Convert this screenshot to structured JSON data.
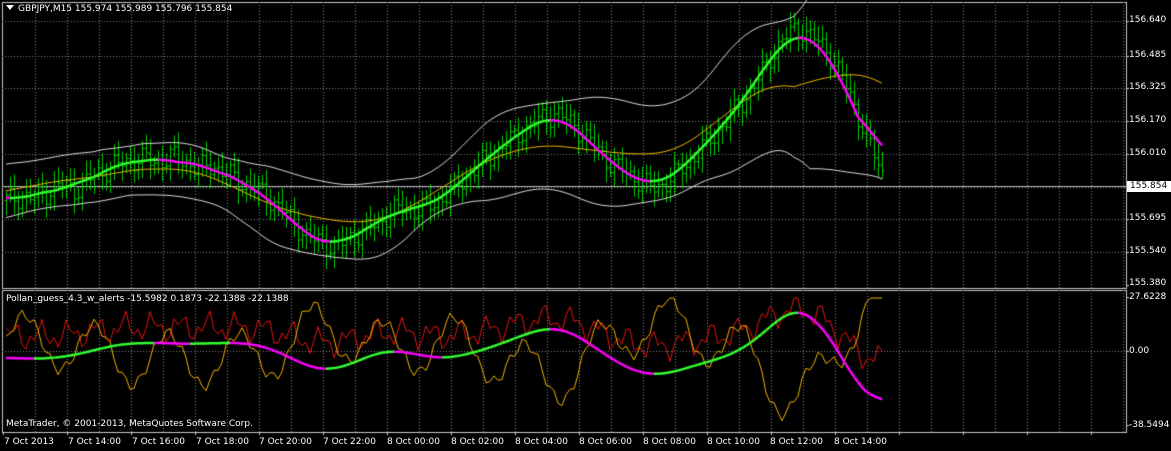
{
  "header": {
    "title": "GBPJPY,M15  155.974 155.989 155.796 155.854"
  },
  "indicator": {
    "title": "Pollan_guess_4.3_w_alerts -15.5982 0.1873 -22.1388 -22.1388"
  },
  "footer": {
    "copyright": "MetaTrader, © 2001-2013, MetaQuotes Software Corp."
  },
  "price_axis": {
    "labels": [
      "156.640",
      "156.485",
      "156.325",
      "156.170",
      "156.010",
      "155.695",
      "155.540",
      "155.380"
    ],
    "current_price": "155.854"
  },
  "indicator_axis": {
    "labels": [
      "27.6228",
      "0.00",
      "-38.5494"
    ]
  },
  "time_axis": {
    "labels": [
      "7 Oct 2013",
      "7 Oct 14:00",
      "7 Oct 16:00",
      "7 Oct 18:00",
      "7 Oct 20:00",
      "7 Oct 22:00",
      "8 Oct 00:00",
      "8 Oct 02:00",
      "8 Oct 04:00",
      "8 Oct 06:00",
      "8 Oct 08:00",
      "8 Oct 10:00",
      "8 Oct 12:00",
      "8 Oct 14:00"
    ]
  },
  "colors": {
    "background": "#000000",
    "grid": "#7f7f7f",
    "bars": "#00c800",
    "ma_up": "#32ff32",
    "ma_down": "#ff00ff",
    "band_outer": "#d8d8d8",
    "band_mid": "#e8b400",
    "ind_red": "#e41414",
    "ind_orange": "#f0b000"
  },
  "chart_data": {
    "type": "line",
    "symbol": "GBPJPY",
    "timeframe": "M15",
    "ylim": [
      155.38,
      156.64
    ],
    "price_closes": [
      155.78,
      155.8,
      155.79,
      155.82,
      155.86,
      155.83,
      155.88,
      155.92,
      155.95,
      155.97,
      155.98,
      155.96,
      155.99,
      155.97,
      155.93,
      155.95,
      155.91,
      155.87,
      155.84,
      155.8,
      155.74,
      155.67,
      155.6,
      155.58,
      155.55,
      155.6,
      155.63,
      155.67,
      155.72,
      155.75,
      155.73,
      155.76,
      155.8,
      155.86,
      155.92,
      155.98,
      156.03,
      156.08,
      156.13,
      156.17,
      156.2,
      156.16,
      156.1,
      156.03,
      155.96,
      155.92,
      155.88,
      155.84,
      155.86,
      155.92,
      155.98,
      156.05,
      156.12,
      156.2,
      156.28,
      156.38,
      156.5,
      156.58,
      156.6,
      156.55,
      156.48,
      156.36,
      156.2,
      156.04,
      155.88
    ],
    "indicator": {
      "ylim": [
        -38.5494,
        27.6228
      ],
      "values": [
        -15.5982,
        0.1873,
        -22.1388,
        -22.1388
      ]
    }
  }
}
